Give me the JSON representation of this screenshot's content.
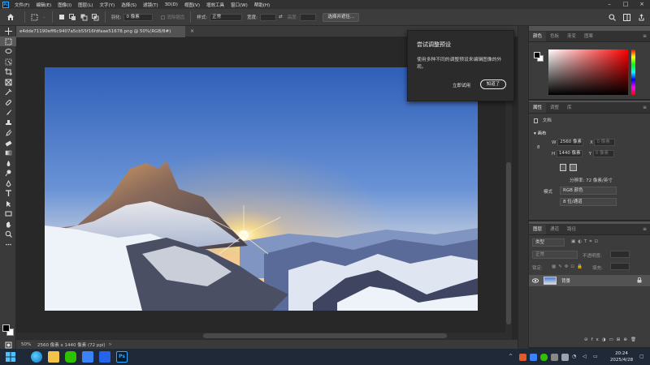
{
  "menu": {
    "items": [
      "文件(F)",
      "编辑(E)",
      "图像(I)",
      "图层(L)",
      "文字(Y)",
      "选择(S)",
      "滤镜(T)",
      "3D(D)",
      "视图(V)",
      "增效工具",
      "窗口(W)",
      "帮助(H)"
    ]
  },
  "options": {
    "feather_label": "羽化:",
    "feather_value": "0 像素",
    "antialias_label": "消除锯齿",
    "style_label": "样式:",
    "style_value": "正常",
    "width_label": "宽度:",
    "height_label": "高度:",
    "select_mask_button": "选择并遮住..."
  },
  "document": {
    "tab_title": "e4dde71190eff6c9407a5cb55f16fdfaae51678.png @ 50%(RGB/8#)",
    "close_glyph": "×"
  },
  "tip": {
    "title": "尝试调整预设",
    "body": "使用多种不同的调整预设来编辑图像的外观。",
    "try_now": "立即试用",
    "got_it": "知道了"
  },
  "status": {
    "zoom": "50%",
    "info": "2560 像素 x 1440 像素 (72 ppi)",
    "arrow": ">"
  },
  "color_panel": {
    "tabs": [
      "颜色",
      "色板",
      "渐变",
      "图案"
    ]
  },
  "properties_panel": {
    "tabs": [
      "属性",
      "调整",
      "库"
    ],
    "doc_label": "文档",
    "canvas_label": "画布",
    "w_label": "W",
    "w_value": "2560 像素",
    "h_label": "H",
    "h_value": "1440 像素",
    "x_label": "X",
    "x_value": "0 像素",
    "y_label": "Y",
    "y_value": "0 像素",
    "resolution": "分辨率: 72 像素/英寸",
    "mode_label": "模式",
    "mode_value": "RGB 颜色",
    "depth_value": "8 位/通道"
  },
  "layers_panel": {
    "tabs": [
      "图层",
      "通道",
      "路径"
    ],
    "kind_label": "类型",
    "blend_mode": "正常",
    "opacity_label": "不透明度:",
    "lock_label": "锁定:",
    "fill_label": "填充:",
    "layer_name": "背景"
  },
  "taskbar": {
    "time": "20:24",
    "date": "2025/4/28"
  },
  "colors": {
    "accent": "#31a8ff",
    "panel_bg": "#3c3c3c",
    "canvas_bg": "#282828",
    "taskbar_bg": "#1f2937"
  }
}
